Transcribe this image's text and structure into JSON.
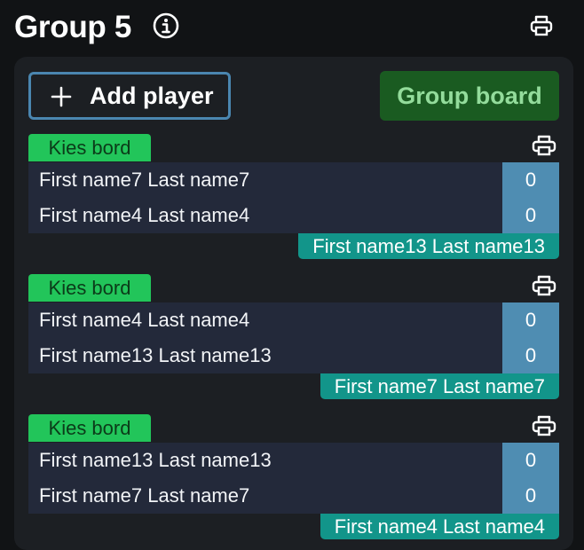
{
  "header": {
    "title": "Group 5",
    "info_icon": "info-circle-icon",
    "print_icon": "printer-icon"
  },
  "toolbar": {
    "add_player_label": "Add player",
    "group_board_label": "Group board"
  },
  "matches": [
    {
      "board_label": "Kies bord",
      "players": [
        {
          "name": "First name7 Last name7",
          "score": "0"
        },
        {
          "name": "First name4 Last name4",
          "score": "0"
        }
      ],
      "referee": "First name13 Last name13"
    },
    {
      "board_label": "Kies bord",
      "players": [
        {
          "name": "First name4 Last name4",
          "score": "0"
        },
        {
          "name": "First name13 Last name13",
          "score": "0"
        }
      ],
      "referee": "First name7 Last name7"
    },
    {
      "board_label": "Kies bord",
      "players": [
        {
          "name": "First name13 Last name13",
          "score": "0"
        },
        {
          "name": "First name7 Last name7",
          "score": "0"
        }
      ],
      "referee": "First name4 Last name4"
    }
  ],
  "colors": {
    "background": "#111315",
    "panel": "#1c1f23",
    "kies_bord": "#22c55a",
    "group_board": "#1a5b21",
    "score": "#4f8db2",
    "referee": "#12958a",
    "add_border": "#4a86b0"
  }
}
